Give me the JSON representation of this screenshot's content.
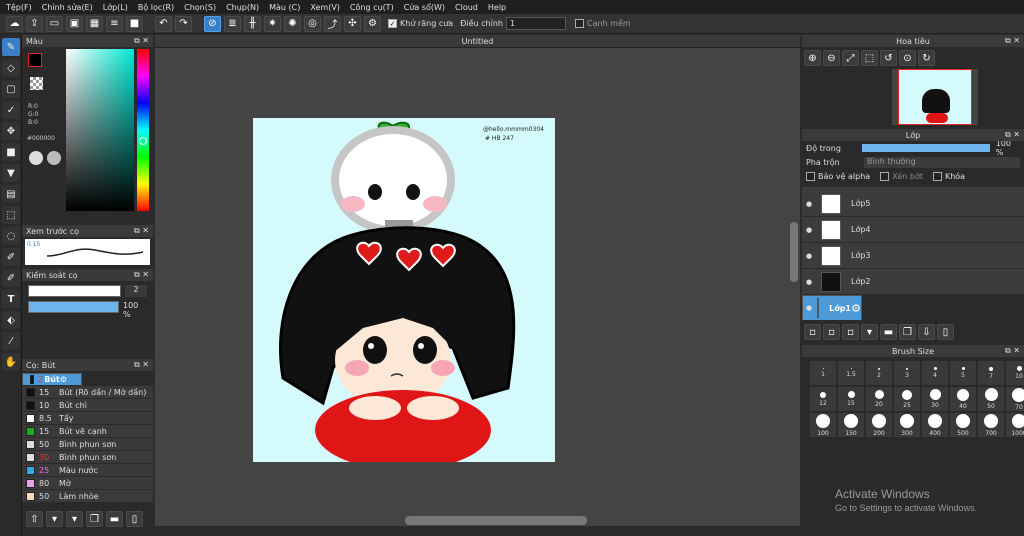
{
  "menu": [
    "Tệp(F)",
    "Chỉnh sửa(E)",
    "Lớp(L)",
    "Bộ lọc(R)",
    "Chọn(S)",
    "Chụp(N)",
    "Màu (C)",
    "Xem(V)",
    "Công cụ(T)",
    "Cửa sổ(W)",
    "Cloud",
    "Help"
  ],
  "toolbar": {
    "antialias_label": "Khử răng cưa",
    "correction_label": "Điều chỉnh",
    "correction_value": "1",
    "soft_edge_label": "Cạnh mềm"
  },
  "left": {
    "color_title": "Màu",
    "rgb": {
      "r": "R:0",
      "g": "G:0",
      "b": "B:0"
    },
    "hex": "#000000",
    "preview_title": "Xem trước cọ",
    "preview_value": "0.15",
    "control_title": "Kiểm soát cọ",
    "size_value": "2",
    "opacity_value": "100 %",
    "brush_title": "Cọ: Bút",
    "brushes": [
      {
        "size": "2",
        "name": "Bút",
        "color": "#111111"
      },
      {
        "size": "15",
        "name": "Bút (Rõ dần / Mờ dần)",
        "color": "#111111"
      },
      {
        "size": "10",
        "name": "Bút chì",
        "color": "#111111"
      },
      {
        "size": "8.5",
        "name": "Tẩy",
        "color": "#ffffff"
      },
      {
        "size": "15",
        "name": "Bút vẽ cạnh",
        "color": "#22aa22"
      },
      {
        "size": "50",
        "name": "Bình phun sơn",
        "color": "#dddddd"
      },
      {
        "size": "30",
        "name": "Bình phun sơn",
        "color": "#dddddd"
      },
      {
        "size": "25",
        "name": "Màu nước",
        "color": "#e36ae3"
      },
      {
        "size": "80",
        "name": "Mờ",
        "color": "#e8a3e8"
      },
      {
        "size": "50",
        "name": "Làm nhòe",
        "color": "#f3d9c0"
      }
    ]
  },
  "document": {
    "title": "Untitled",
    "signature_line1": "@hello.mmmm0304",
    "signature_line2": "# HB 247"
  },
  "right": {
    "nav_title": "Hoa tiêu",
    "layer_title": "Lớp",
    "opacity_label": "Độ trong",
    "opacity_value": "100 %",
    "blend_label": "Pha trộn",
    "blend_value": "Bình thường",
    "protect_alpha": "Bảo vệ alpha",
    "clipping": "Xén bớt",
    "lock": "Khóa",
    "layers": [
      "Lớp5",
      "Lớp4",
      "Lớp3",
      "Lớp2",
      "Lớp1"
    ],
    "brushsize_title": "Brush Size",
    "sizes": [
      "1",
      "1.5",
      "2",
      "3",
      "4",
      "5",
      "7",
      "10",
      "12",
      "15",
      "20",
      "25",
      "30",
      "40",
      "50",
      "70",
      "100",
      "150",
      "200",
      "300",
      "400",
      "500",
      "700",
      "1000"
    ]
  },
  "watermark": {
    "title": "Activate Windows",
    "subtitle": "Go to Settings to activate Windows."
  },
  "colors": {
    "accent": "#3a7fc7",
    "canvas_bg": "#d5fafb"
  }
}
